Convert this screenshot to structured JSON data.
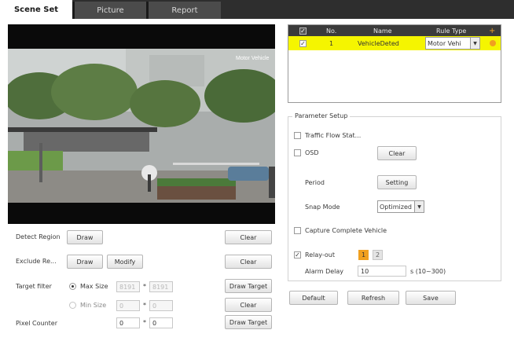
{
  "tabs": [
    {
      "label": "Scene Set",
      "active": true
    },
    {
      "label": "Picture",
      "active": false
    },
    {
      "label": "Report",
      "active": false
    }
  ],
  "video": {
    "overlay_text": "Motor Vehicle"
  },
  "left_controls": {
    "detect_region": {
      "label": "Detect Region",
      "draw": "Draw",
      "clear": "Clear"
    },
    "exclude_region": {
      "label": "Exclude Re...",
      "draw": "Draw",
      "modify": "Modify",
      "clear": "Clear"
    },
    "target_filter": {
      "label": "Target filter",
      "max_size": {
        "label": "Max Size",
        "w": "8191",
        "h": "8191",
        "selected": true
      },
      "min_size": {
        "label": "Min Size",
        "w": "0",
        "h": "0",
        "selected": false
      },
      "draw_target": "Draw Target",
      "clear": "Clear"
    },
    "pixel_counter": {
      "label": "Pixel Counter",
      "w": "0",
      "h": "0",
      "draw_target": "Draw Target"
    },
    "times": "*"
  },
  "rule_table": {
    "headers": {
      "check": "✓",
      "no": "No.",
      "name": "Name",
      "rule_type": "Rule Type",
      "add": "+"
    },
    "rows": [
      {
        "checked": "✓",
        "no": "1",
        "name": "VehicleDeted",
        "rule_type": "Motor Vehi",
        "status_color": "#f0a020"
      }
    ]
  },
  "parameter_setup": {
    "legend": "Parameter Setup",
    "traffic_flow": {
      "label": "Traffic Flow Stat...",
      "checked": false
    },
    "osd": {
      "label": "OSD",
      "checked": false,
      "clear": "Clear"
    },
    "period": {
      "label": "Period",
      "button": "Setting"
    },
    "snap_mode": {
      "label": "Snap Mode",
      "value": "Optimized"
    },
    "capture_complete": {
      "label": "Capture Complete Vehicle",
      "checked": false
    },
    "relay_out": {
      "label": "Relay-out",
      "checked": true,
      "options": [
        "1",
        "2"
      ],
      "active": "1"
    },
    "alarm_delay": {
      "label": "Alarm Delay",
      "value": "10",
      "unit": "s (10~300)"
    }
  },
  "footer": {
    "default": "Default",
    "refresh": "Refresh",
    "save": "Save"
  },
  "colors": {
    "rule_row": "#f5f500",
    "relay_active": "#f0a020",
    "header_bg": "#3b3b3b"
  }
}
